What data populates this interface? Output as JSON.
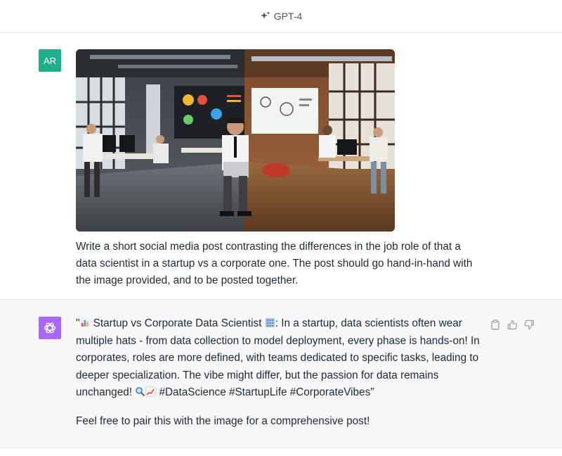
{
  "header": {
    "model_label": "GPT-4",
    "model_icon": "sparkle-icon"
  },
  "user_message": {
    "avatar_initials": "AR",
    "avatar_color": "#1fb08a",
    "text": "Write a short social media post contrasting the differences in the job role of that a data scientist in a startup vs a corporate one. The post should go hand-in-hand with the image provided, and to be posted together."
  },
  "assistant_message": {
    "avatar_color": "#ab68ff",
    "para1_a": "\"",
    "para1_b": " Startup vs Corporate Data Scientist ",
    "para1_c": ": In a startup, data scientists often wear multiple hats - from data collection to model deployment, every phase is hands-on! In corporates, roles are more defined, with teams dedicated to specific tasks, leading to deeper specialization. The vibe might differ, but the passion for data remains unchanged! ",
    "para1_d": " #DataScience #StartupLife #CorporateVibes\"",
    "para2": "Feel free to pair this with the image for a comprehensive post!",
    "actions": [
      "clipboard-icon",
      "thumbs-up-icon",
      "thumbs-down-icon"
    ]
  }
}
